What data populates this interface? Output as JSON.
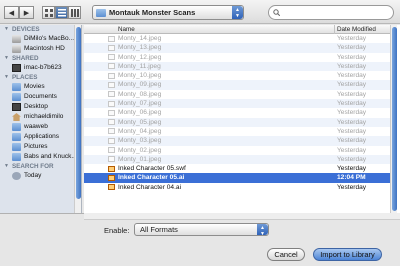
{
  "toolbar": {
    "back_icon": "◀",
    "forward_icon": "▶",
    "location": "Montauk Monster Scans",
    "search_placeholder": ""
  },
  "sidebar": {
    "devices_header": "DEVICES",
    "devices": [
      "DiMilo's MacBo...",
      "Macintosh HD"
    ],
    "shared_header": "SHARED",
    "shared": [
      "imac-b7b623"
    ],
    "places_header": "PLACES",
    "places": [
      "Movies",
      "Documents",
      "Desktop",
      "michaeldimilo",
      "waaweb",
      "Applications",
      "Pictures",
      "Babs and Knuck..."
    ],
    "search_header": "SEARCH FOR",
    "search_for": [
      "Today"
    ]
  },
  "list": {
    "col_name": "Name",
    "col_date": "Date Modified",
    "rows": [
      {
        "name": "Monty_14.jpeg",
        "date": "Yesterday",
        "enabled": false
      },
      {
        "name": "Monty_13.jpeg",
        "date": "Yesterday",
        "enabled": false
      },
      {
        "name": "Monty_12.jpeg",
        "date": "Yesterday",
        "enabled": false
      },
      {
        "name": "Monty_11.jpeg",
        "date": "Yesterday",
        "enabled": false
      },
      {
        "name": "Monty_10.jpeg",
        "date": "Yesterday",
        "enabled": false
      },
      {
        "name": "Monty_09.jpeg",
        "date": "Yesterday",
        "enabled": false
      },
      {
        "name": "Monty_08.jpeg",
        "date": "Yesterday",
        "enabled": false
      },
      {
        "name": "Monty_07.jpeg",
        "date": "Yesterday",
        "enabled": false
      },
      {
        "name": "Monty_06.jpeg",
        "date": "Yesterday",
        "enabled": false
      },
      {
        "name": "Monty_05.jpeg",
        "date": "Yesterday",
        "enabled": false
      },
      {
        "name": "Monty_04.jpeg",
        "date": "Yesterday",
        "enabled": false
      },
      {
        "name": "Monty_03.jpeg",
        "date": "Yesterday",
        "enabled": false
      },
      {
        "name": "Monty_02.jpeg",
        "date": "Yesterday",
        "enabled": false
      },
      {
        "name": "Monty_01.jpeg",
        "date": "Yesterday",
        "enabled": false
      },
      {
        "name": "Inked Character 05.swf",
        "date": "Yesterday",
        "enabled": true
      },
      {
        "name": "Inked Character 05.ai",
        "date": "12:04 PM",
        "enabled": true,
        "selected": true
      },
      {
        "name": "Inked Character 04.ai",
        "date": "Yesterday",
        "enabled": true
      }
    ]
  },
  "footer": {
    "enable_label": "Enable:",
    "format_value": "All Formats",
    "cancel_label": "Cancel",
    "import_label": "Import to Library"
  },
  "colors": {
    "selection": "#3b6fd6",
    "sidebar": "#dde3ec"
  }
}
